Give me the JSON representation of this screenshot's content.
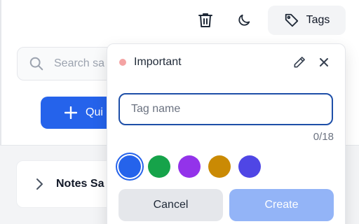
{
  "toolbar": {
    "trash_icon": "trash-icon",
    "theme_icon": "moon-icon",
    "tags_icon": "tag-icon",
    "tags_label": "Tags"
  },
  "search": {
    "placeholder": "Search sa"
  },
  "quick_button": {
    "label": "Qui"
  },
  "notes_card": {
    "title": "Notes Sa"
  },
  "popover": {
    "tag_title": "Important",
    "tag_dot_color": "#f4a3a3",
    "input_placeholder": "Tag name",
    "input_value": "",
    "char_count": "0/18",
    "colors": [
      "#2563eb",
      "#16a34a",
      "#9333ea",
      "#ca8a04",
      "#4f46e5"
    ],
    "selected_color_index": 0,
    "cancel_label": "Cancel",
    "create_label": "Create"
  },
  "theme": {
    "accent": "#2563eb",
    "create_disabled": "#93b4f7"
  }
}
